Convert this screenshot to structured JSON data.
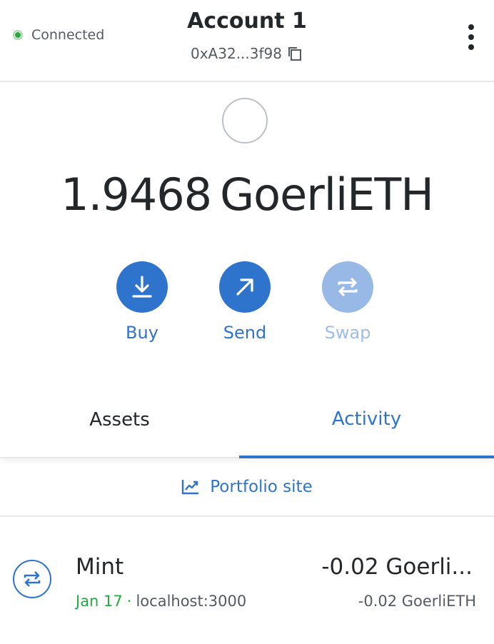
{
  "header": {
    "connection_status": "Connected",
    "account_name": "Account 1",
    "address": "0xA32...3f98",
    "icons": {
      "status": "connected-dot-icon",
      "copy": "copy-icon",
      "menu": "kebab-menu-icon"
    }
  },
  "balance": {
    "amount": "1.9468",
    "currency": "GoerliETH"
  },
  "actions": [
    {
      "label": "Buy",
      "icon": "download-icon",
      "enabled": true
    },
    {
      "label": "Send",
      "icon": "arrow-up-right-icon",
      "enabled": true
    },
    {
      "label": "Swap",
      "icon": "swap-icon",
      "enabled": false
    }
  ],
  "tabs": [
    {
      "label": "Assets",
      "active": false
    },
    {
      "label": "Activity",
      "active": true
    }
  ],
  "portfolio": {
    "label": "Portfolio site",
    "icon": "chart-line-icon"
  },
  "activity": [
    {
      "title": "Mint",
      "date": "Jan 17",
      "separator": "·",
      "origin": "localhost:3000",
      "amount_primary": "-0.02 Goerli...",
      "amount_secondary": "-0.02 GoerliETH",
      "icon": "swap-arrows-icon"
    }
  ],
  "colors": {
    "primary": "#2f74cc",
    "primary_disabled": "#98b9e6",
    "success": "#28a745",
    "text": "#24272a",
    "muted": "#535a61",
    "divider": "#e6e7e8"
  }
}
